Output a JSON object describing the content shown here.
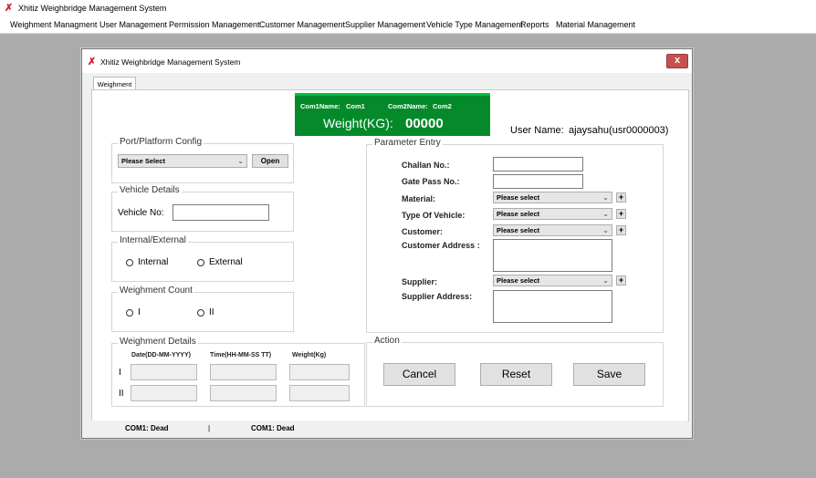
{
  "app": {
    "title": "Xhitiz Weighbridge Management System"
  },
  "menu": [
    "Weighment Managment",
    "User Management",
    "Permission Management",
    "Customer Management",
    "Supplier Management",
    "Vehicle Type Management",
    "Reports",
    "Material Management"
  ],
  "window": {
    "title": "Xhitiz Weighbridge Management System",
    "close_glyph": "x"
  },
  "tab": "Weighment",
  "weight": {
    "com1_label": "Com1Name:",
    "com1_value": "Com1",
    "com2_label": "Com2Name:",
    "com2_value": "Com2",
    "label": "Weight(KG):",
    "value": "00000"
  },
  "user": {
    "label": "User Name:",
    "value": "ajaysahu(usr0000003)"
  },
  "port": {
    "legend": "Port/Platform Config",
    "select_value": "Please Select",
    "open_label": "Open"
  },
  "vehicle": {
    "legend": "Vehicle Details",
    "label": "Vehicle No:",
    "value": ""
  },
  "internal_external": {
    "legend": "Internal/External",
    "option1": "Internal",
    "option2": "External"
  },
  "weighment_count": {
    "legend": "Weighment Count",
    "option1": "I",
    "option2": "II"
  },
  "weighment_details": {
    "legend": "Weighment Details",
    "col_date": "Date(DD-MM-YYYY)",
    "col_time": "Time(HH-MM-SS TT)",
    "col_weight": "Weight(Kg)",
    "row1": "I",
    "row2": "II"
  },
  "parameter": {
    "legend": "Parameter Entry",
    "challan_label": "Challan No.:",
    "gatepass_label": "Gate Pass No.:",
    "material_label": "Material:",
    "material_value": "Please select",
    "vehicle_type_label": "Type Of Vehicle:",
    "vehicle_type_value": "Please select",
    "customer_label": "Customer:",
    "customer_value": "Please select",
    "customer_address_label": "Customer Address :",
    "supplier_label": "Supplier:",
    "supplier_value": "Please select",
    "supplier_address_label": "Supplier Address:",
    "plus": "+"
  },
  "action": {
    "legend": "Action",
    "cancel": "Cancel",
    "reset": "Reset",
    "save": "Save"
  },
  "status": {
    "left": "COM1: Dead",
    "sep": "|",
    "right": "COM1: Dead"
  },
  "colors": {
    "weight_panel": "#048a2a",
    "close_button": "#c75050"
  }
}
